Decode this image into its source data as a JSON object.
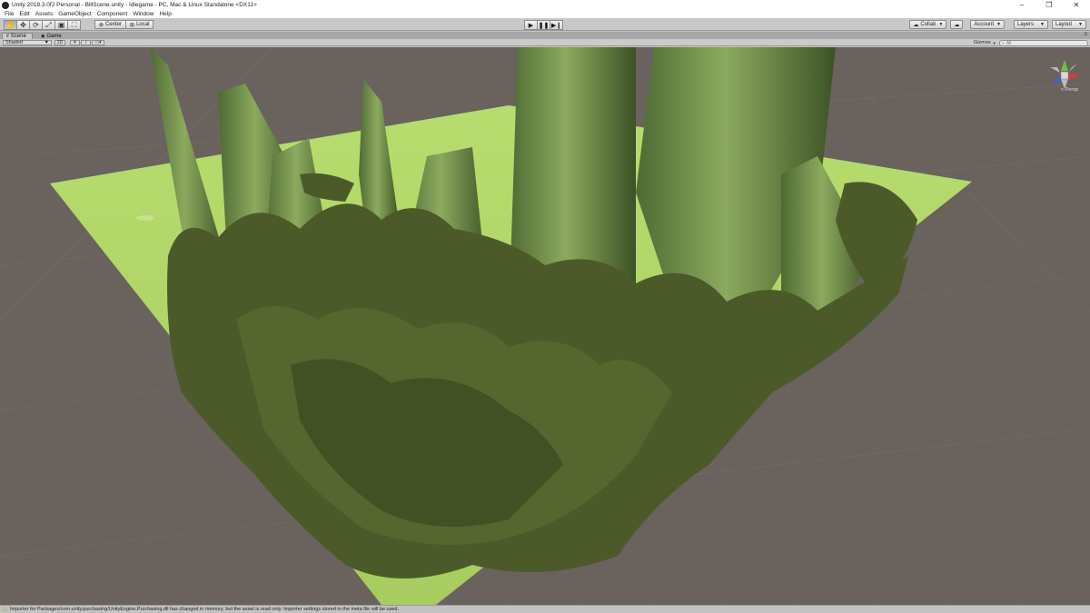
{
  "window": {
    "title": "Unity 2018.3.0f2 Personal - BillScene.unity - Idlegame - PC, Mac & Linux Standalone <DX11>",
    "controls": [
      "–",
      "❐",
      "✕"
    ]
  },
  "menu": [
    "File",
    "Edit",
    "Assets",
    "GameObject",
    "Component",
    "Window",
    "Help"
  ],
  "toolbar": {
    "tools": [
      "hand-icon",
      "move-icon",
      "rotate-icon",
      "scale-icon",
      "rect-icon",
      "transform-icon"
    ],
    "pivot_label": "Center",
    "space_label": "Local",
    "collab_label": "Collab",
    "account_label": "Account",
    "layers_label": "Layers",
    "layout_label": "Layout"
  },
  "tabs": {
    "scene": "Scene",
    "game": "Game"
  },
  "scene_controls": {
    "draw_mode": "Shaded",
    "mode_2d": "2D",
    "gizmos_label": "Gizmos",
    "search_placeholder": "All"
  },
  "viewport": {
    "projection_label": "< Persp",
    "colors": {
      "background": "#6a625d",
      "ground": "#9fc65a",
      "terrain": "#6f8a4a",
      "trees": "#4b5a28"
    }
  },
  "status": {
    "message": "Importer for Packages/com.unity.purchasing/UnityEngine.Purchasing.dll has changed in memory, but the asset is read only. Importer settings stored in the meta file will be used."
  }
}
